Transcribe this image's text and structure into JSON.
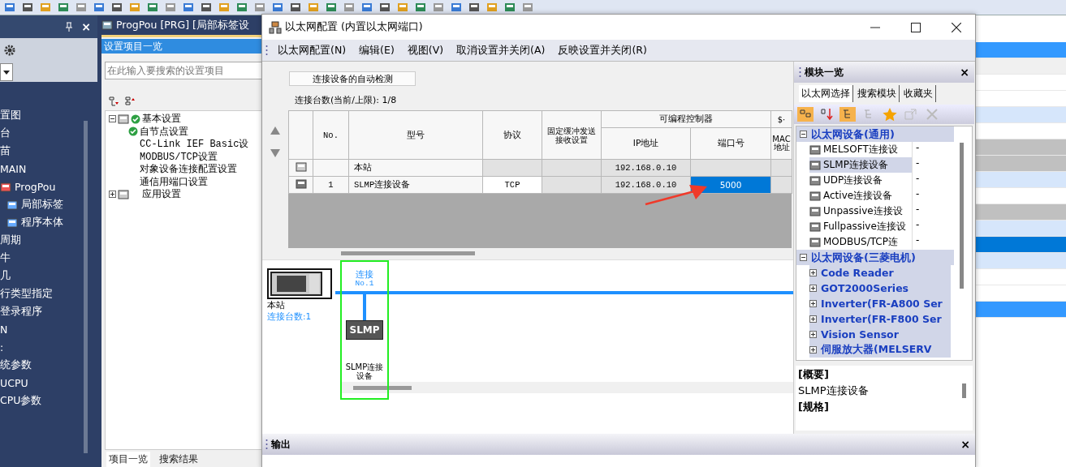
{
  "navigator": {
    "close": "×",
    "items": [
      {
        "label": "置图"
      },
      {
        "label": "台"
      },
      {
        "label": "苗"
      },
      {
        "label": "MAIN"
      },
      {
        "label": "ProgPou",
        "icon": true,
        "children": [
          {
            "label": "局部标签",
            "icon": true
          },
          {
            "label": "程序本体",
            "icon": true
          }
        ]
      },
      {
        "label": "周期"
      },
      {
        "label": "牛"
      },
      {
        "label": "几"
      },
      {
        "label": "行类型指定"
      },
      {
        "label": "登录程序"
      },
      {
        "label": "N"
      },
      {
        "label": ":"
      },
      {
        "label": "统参数"
      },
      {
        "label": "UCPU"
      },
      {
        "label": "CPU参数"
      }
    ]
  },
  "editor_tab": {
    "title": "ProgPou [PRG] [局部标签设"
  },
  "settings_panel": {
    "title": "设置项目一览",
    "search": {
      "placeholder": "在此输入要搜索的设置项目"
    },
    "tree": [
      {
        "label": "基本设置",
        "expanded": true,
        "checked": true,
        "children": [
          {
            "label": "自节点设置",
            "checked": true
          },
          {
            "label": "CC-Link IEF Basic设",
            "checked": false
          },
          {
            "label": "MODBUS/TCP设置",
            "checked": false
          },
          {
            "label": "对象设备连接配置设置",
            "checked": false
          },
          {
            "label": "通信用端口设置",
            "checked": false
          }
        ]
      },
      {
        "label": "应用设置",
        "expanded": false,
        "checked": false
      }
    ],
    "tabs": [
      {
        "label": "项目一览",
        "selected": true
      },
      {
        "label": "搜索结果",
        "selected": false
      }
    ]
  },
  "dialog": {
    "title": "以太网配置 (内置以太网端口)",
    "menu": [
      "以太网配置(N)",
      "编辑(E)",
      "视图(V)",
      "取消设置并关闭(A)",
      "反映设置并关闭(R)"
    ],
    "detect_button": "连接设备的自动检测",
    "count_label": "连接台数(当前/上限):  1/8",
    "table": {
      "columns": [
        "No.",
        "型号",
        "协议",
        "固定缓冲发送接收设置",
        "IP地址",
        "端口号",
        "$·",
        "MAC地址"
      ],
      "group_header": "可编程控制器",
      "rows": [
        {
          "kind": "station",
          "model": "本站",
          "ip": "192.168.0.10",
          "port_selected": false
        },
        {
          "kind": "device",
          "no": "1",
          "model": "SLMP连接设备",
          "protocol": "TCP",
          "ip": "192.168.0.10",
          "port": "5000",
          "port_selected": true
        }
      ]
    },
    "diagram": {
      "station_label": "本站",
      "station_count": "连接台数:1",
      "connection_label": "连接",
      "connection_no": "No.1",
      "device_box": "SLMP",
      "device_label": "SLMP连接设备"
    }
  },
  "module_panel": {
    "title": "模块一览",
    "close": "×",
    "tabs": [
      {
        "label": "以太网选择",
        "selected": true
      },
      {
        "label": "搜索模块",
        "selected": false
      },
      {
        "label": "收藏夹",
        "selected": false
      }
    ],
    "groups": [
      {
        "label": "以太网设备(通用)",
        "expanded": true,
        "items": [
          {
            "label": "MELSOFT连接设",
            "value": "-",
            "selected": false
          },
          {
            "label": "SLMP连接设备",
            "value": "-",
            "selected": true
          },
          {
            "label": "UDP连接设备",
            "value": "-",
            "selected": false
          },
          {
            "label": "Active连接设备",
            "value": "-",
            "selected": false
          },
          {
            "label": "Unpassive连接设",
            "value": "-",
            "selected": false
          },
          {
            "label": "Fullpassive连接设",
            "value": "-",
            "selected": false
          },
          {
            "label": "MODBUS/TCP连",
            "value": "-",
            "selected": false
          }
        ]
      },
      {
        "label": "以太网设备(三菱电机)",
        "expanded": true,
        "items": [
          {
            "label": "Code Reader",
            "kind": "folder"
          },
          {
            "label": "GOT2000Series",
            "kind": "folder"
          },
          {
            "label": "Inverter(FR-A800 Ser",
            "kind": "folder"
          },
          {
            "label": "Inverter(FR-F800 Ser",
            "kind": "folder"
          },
          {
            "label": "Vision Sensor",
            "kind": "folder"
          },
          {
            "label": "伺服放大器(MELSERV",
            "kind": "folder"
          }
        ]
      }
    ],
    "description": [
      "[概要]",
      "SLMP连接设备",
      "[规格]"
    ]
  },
  "output_panel": {
    "title": "输出",
    "close": "×"
  },
  "background_rows": [
    {
      "color": "#3399ff"
    },
    {
      "color": "#f0f0f0"
    },
    {
      "color": "#ffffff"
    },
    {
      "color": "#ffffff"
    },
    {
      "color": "#d6e6fb"
    },
    {
      "color": "#ffffff"
    },
    {
      "color": "#c0c0c0"
    },
    {
      "color": "#c0c0c0"
    },
    {
      "color": "#d6e6fb"
    },
    {
      "color": "#ffffff"
    },
    {
      "color": "#c0c0c0"
    },
    {
      "color": "#d6e6fb"
    },
    {
      "color": "#0078d7"
    },
    {
      "color": "#d6e6fb"
    },
    {
      "color": "#ffffff"
    },
    {
      "color": "#ffffff"
    },
    {
      "color": "#3399ff"
    }
  ]
}
